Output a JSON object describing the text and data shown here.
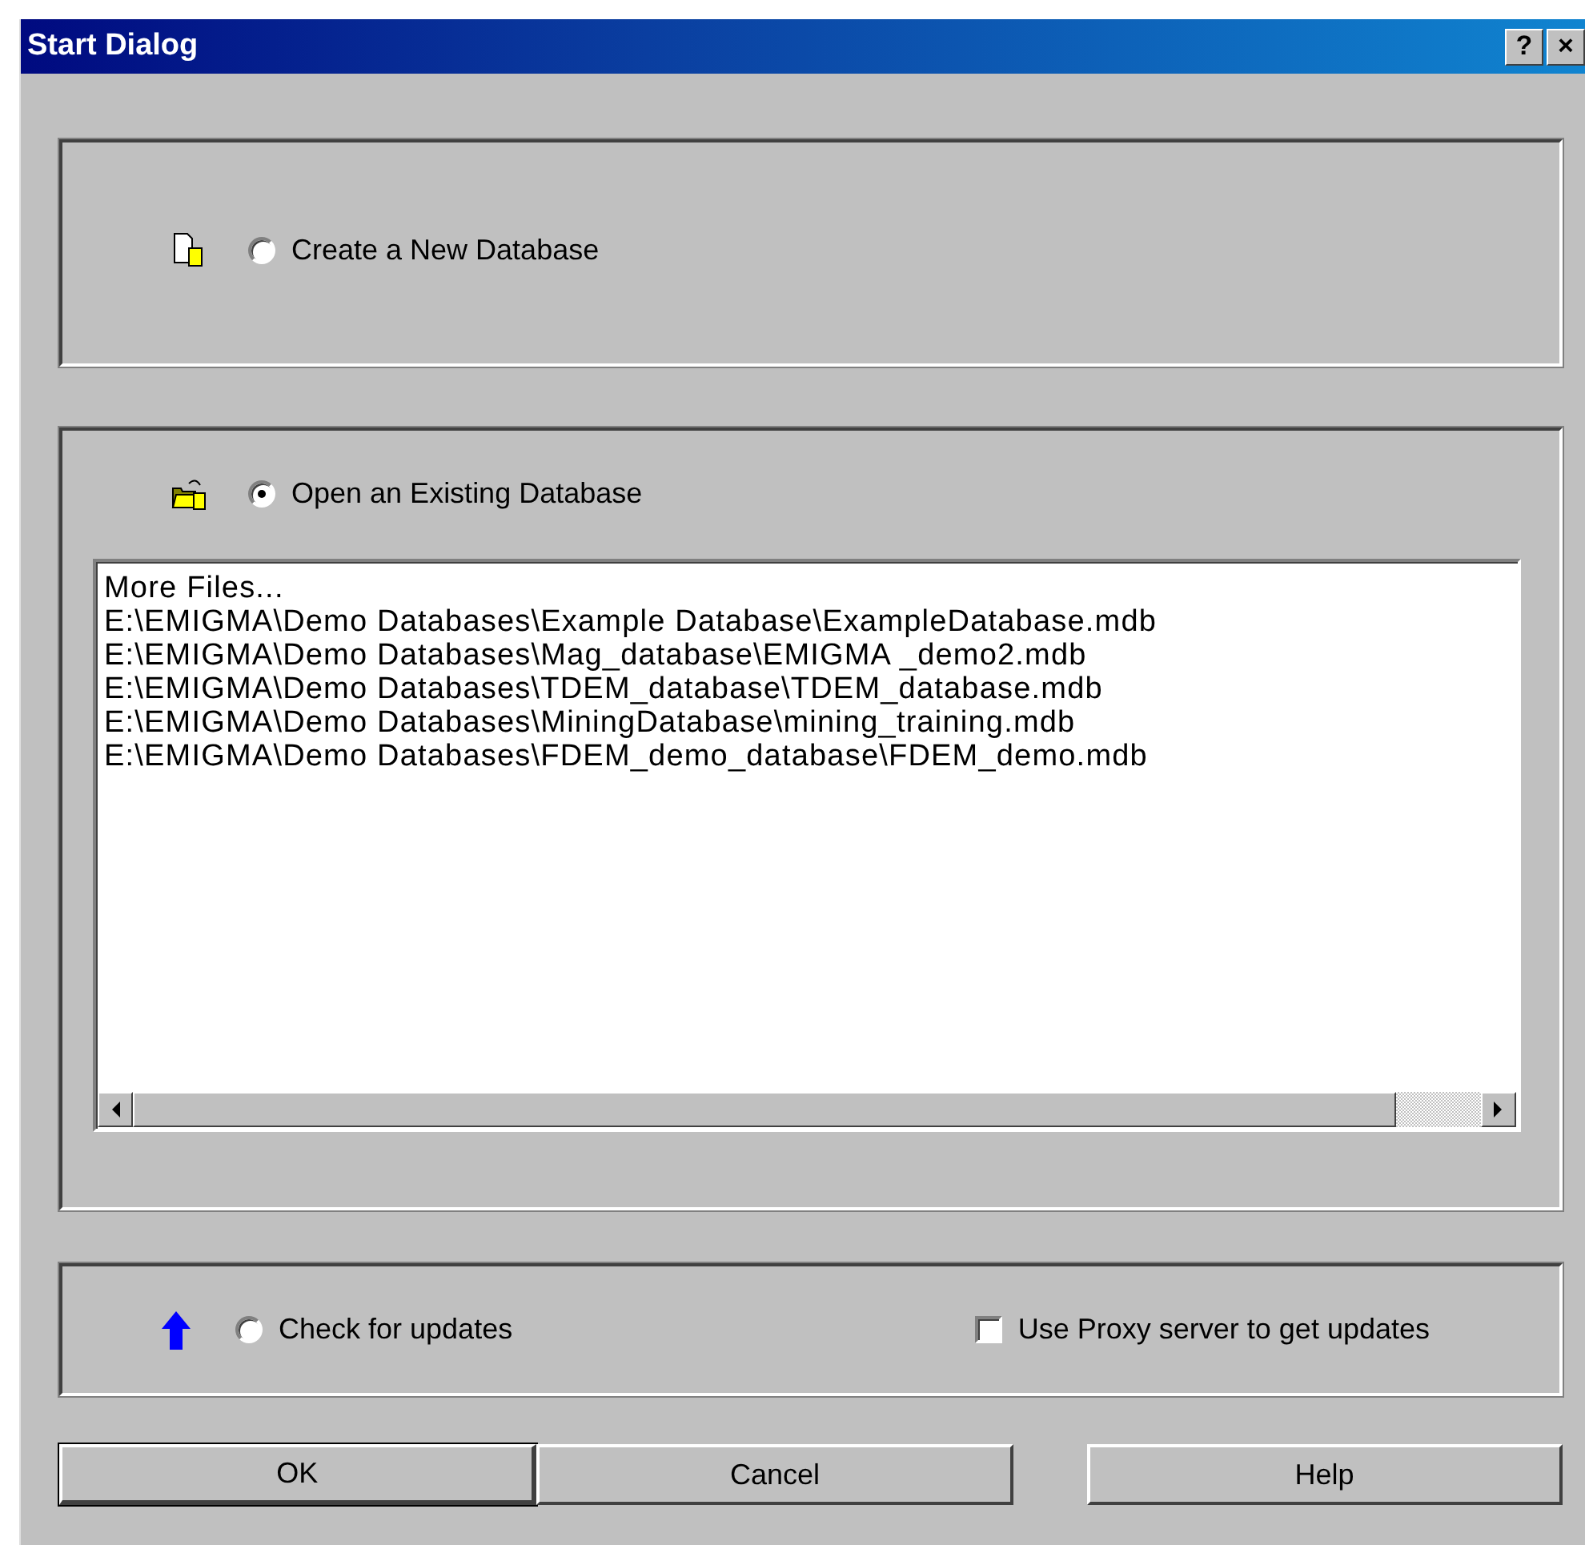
{
  "window": {
    "title": "Start Dialog",
    "controls": [
      "?",
      "×"
    ]
  },
  "new_database": {
    "label": "Create a New Database",
    "selected": false
  },
  "open_database": {
    "label": "Open an Existing Database",
    "selected": true,
    "files": [
      "More Files...",
      "E:\\EMIGMA\\Demo Databases\\Example Database\\ExampleDatabase.mdb",
      "E:\\EMIGMA\\Demo Databases\\Mag_database\\EMIGMA _demo2.mdb",
      "E:\\EMIGMA\\Demo Databases\\TDEM_database\\TDEM_database.mdb",
      "E:\\EMIGMA\\Demo Databases\\MiningDatabase\\mining_training.mdb",
      "E:\\EMIGMA\\Demo Databases\\FDEM_demo_database\\FDEM_demo.mdb"
    ]
  },
  "updates": {
    "label": "Check for updates",
    "selected": false,
    "proxy": {
      "label": "Use Proxy server to get updates",
      "checked": false
    }
  },
  "buttons": [
    {
      "label": "OK",
      "default": true
    },
    {
      "label": "Cancel",
      "default": false
    },
    {
      "label": "Help",
      "default": false
    }
  ]
}
